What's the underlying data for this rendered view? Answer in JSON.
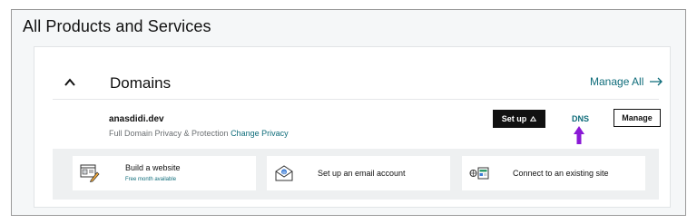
{
  "page": {
    "title": "All Products and Services"
  },
  "domains_card": {
    "title": "Domains",
    "manage_all_label": "Manage All",
    "domain": {
      "name": "anasdidi.dev",
      "privacy_text": "Full Domain Privacy & Protection",
      "privacy_link": "Change Privacy"
    },
    "buttons": {
      "setup_label": "Set up",
      "dns_label": "DNS",
      "manage_label": "Manage"
    },
    "tiles": [
      {
        "label": "Build a website",
        "sublabel": "Free month available",
        "icon": "website-builder-icon"
      },
      {
        "label": "Set up an email account",
        "icon": "email-icon"
      },
      {
        "label": "Connect to an existing site",
        "icon": "connect-site-icon"
      }
    ]
  },
  "colors": {
    "link": "#0e6c7a",
    "annotation_arrow": "#8a19d6",
    "primary_button": "#111111"
  },
  "icons": {
    "collapse": "chevron-up-icon",
    "manage_all": "arrow-right-icon",
    "setup": "caret-up-icon",
    "annotation": "up-arrow-annotation-icon"
  }
}
